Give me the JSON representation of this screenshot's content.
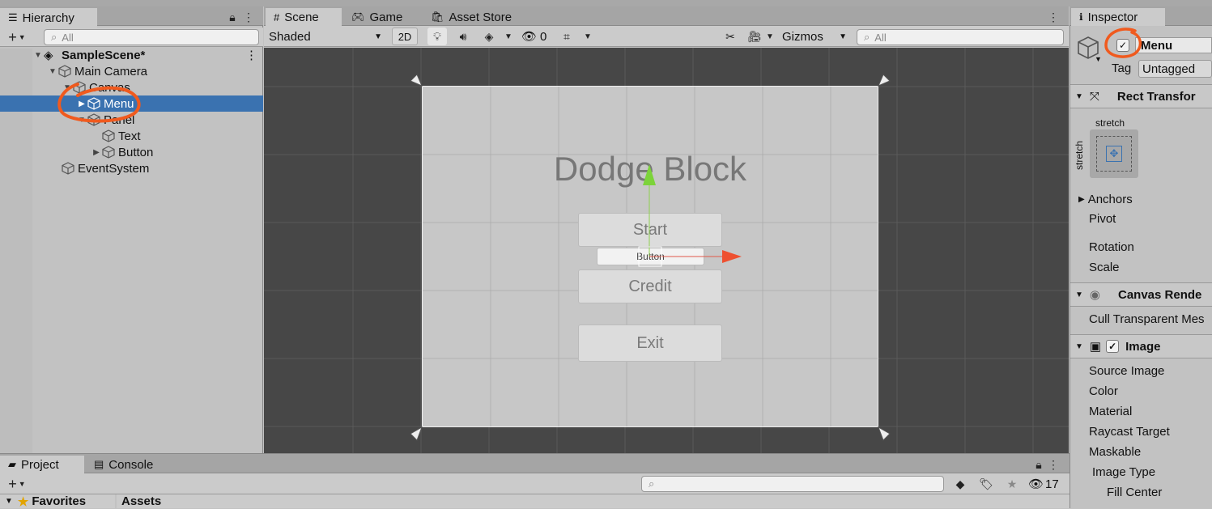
{
  "hierarchy": {
    "tab_label": "Hierarchy",
    "search_placeholder": "All",
    "scene_name": "SampleScene*",
    "items": [
      {
        "label": "Main Camera"
      },
      {
        "label": "Canvas"
      },
      {
        "label": "Menu"
      },
      {
        "label": "Panel"
      },
      {
        "label": "Text"
      },
      {
        "label": "Button"
      },
      {
        "label": "EventSystem"
      }
    ]
  },
  "scene": {
    "tabs": [
      {
        "label": "Scene"
      },
      {
        "label": "Game"
      },
      {
        "label": "Asset Store"
      }
    ],
    "shading_mode": "Shaded",
    "mode_2d": "2D",
    "hidden_count": "0",
    "gizmos_label": "Gizmos",
    "search_placeholder": "All",
    "game_title": "Dodge Block",
    "buttons": [
      {
        "label": "Start"
      },
      {
        "label": "Button"
      },
      {
        "label": "Credit"
      },
      {
        "label": "Exit"
      }
    ]
  },
  "inspector": {
    "tab_label": "Inspector",
    "object_name": "Menu",
    "tag_label": "Tag",
    "tag_value": "Untagged",
    "rect_transform": "Rect Transfor",
    "stretch_top": "stretch",
    "stretch_side": "stretch",
    "anchors": "Anchors",
    "pivot": "Pivot",
    "rotation": "Rotation",
    "scale": "Scale",
    "canvas_renderer": "Canvas Rende",
    "cull": "Cull Transparent Mes",
    "image": "Image",
    "image_props": [
      "Source Image",
      "Color",
      "Material",
      "Raycast Target",
      "Maskable",
      "Image Type",
      "Fill Center"
    ]
  },
  "bottom": {
    "tabs": [
      {
        "label": "Project"
      },
      {
        "label": "Console"
      }
    ],
    "favorites": "Favorites",
    "assets": "Assets",
    "hidden_count": "17"
  },
  "colors": {
    "selection": "#3a72b0",
    "scene_bg": "#474747",
    "canvas_bg": "#c7c7c7",
    "annotation": "#f05a1e"
  }
}
